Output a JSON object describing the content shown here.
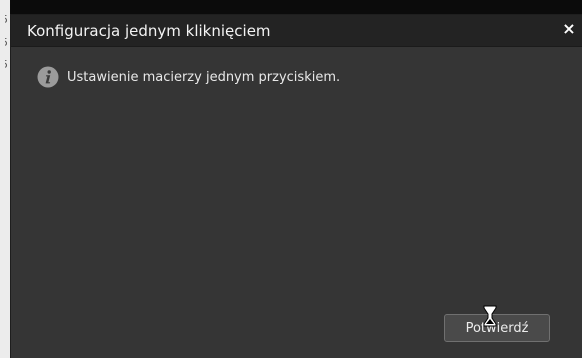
{
  "background_fragments": [
    "5",
    "5",
    "5"
  ],
  "dialog": {
    "title": "Konfiguracja jednym kliknięciem",
    "close_glyph": "×",
    "message_icon": "info-icon",
    "message": "Ustawienie macierzy jednym przyciskiem.",
    "confirm_label": "Potwierdź"
  },
  "colors": {
    "dialog_background": "#353535",
    "titlebar_background": "#232323",
    "button_background": "#4a4a4a"
  }
}
